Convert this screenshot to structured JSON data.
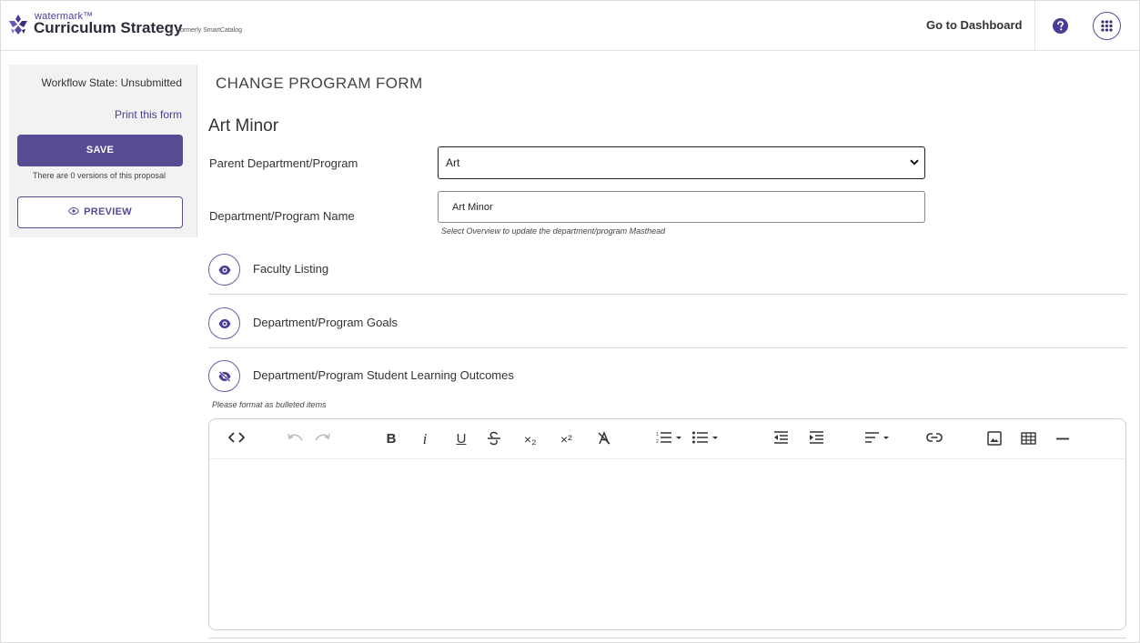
{
  "header": {
    "brand_small": "watermark™",
    "brand_name": "Curriculum Strategy",
    "brand_separator": "|",
    "brand_former": "formerly SmartCatalog",
    "dashboard_link": "Go to Dashboard",
    "icons": [
      "watermark-logo-icon",
      "help-icon",
      "app-grid-icon"
    ]
  },
  "sidebar": {
    "workflow_state": "Workflow State: Unsubmitted",
    "print_link": "Print this form",
    "save_label": "SAVE",
    "versions_text": "There are 0 versions of this proposal",
    "preview_label": "PREVIEW"
  },
  "form": {
    "heading": "CHANGE PROGRAM FORM",
    "program_title": "Art Minor",
    "parent_label": "Parent Department/Program",
    "parent_value": "Art",
    "name_label": "Department/Program Name",
    "name_value": "Art Minor",
    "name_hint": "Select Overview to update the department/program Masthead"
  },
  "sections": [
    {
      "title": "Faculty Listing",
      "icon": "eye-icon"
    },
    {
      "title": "Department/Program Goals",
      "icon": "eye-icon"
    },
    {
      "title": "Department/Program Student Learning Outcomes",
      "icon": "eye-off-icon"
    }
  ],
  "editor": {
    "format_note": "Please format as bulleted items",
    "toolbar": {
      "bold": "B",
      "italic": "i",
      "underline": "U",
      "subscript": "×₂",
      "superscript": "×²",
      "tools": [
        "code-view",
        "undo",
        "redo",
        "bold",
        "italic",
        "underline",
        "strikethrough",
        "subscript",
        "superscript",
        "clear-format",
        "ordered-list",
        "bullet-list",
        "outdent",
        "indent",
        "align",
        "link",
        "image",
        "table",
        "horizontal-rule"
      ]
    },
    "content": ""
  },
  "colors": {
    "accent": "#584b93",
    "brand_text": "#4b3a96"
  }
}
